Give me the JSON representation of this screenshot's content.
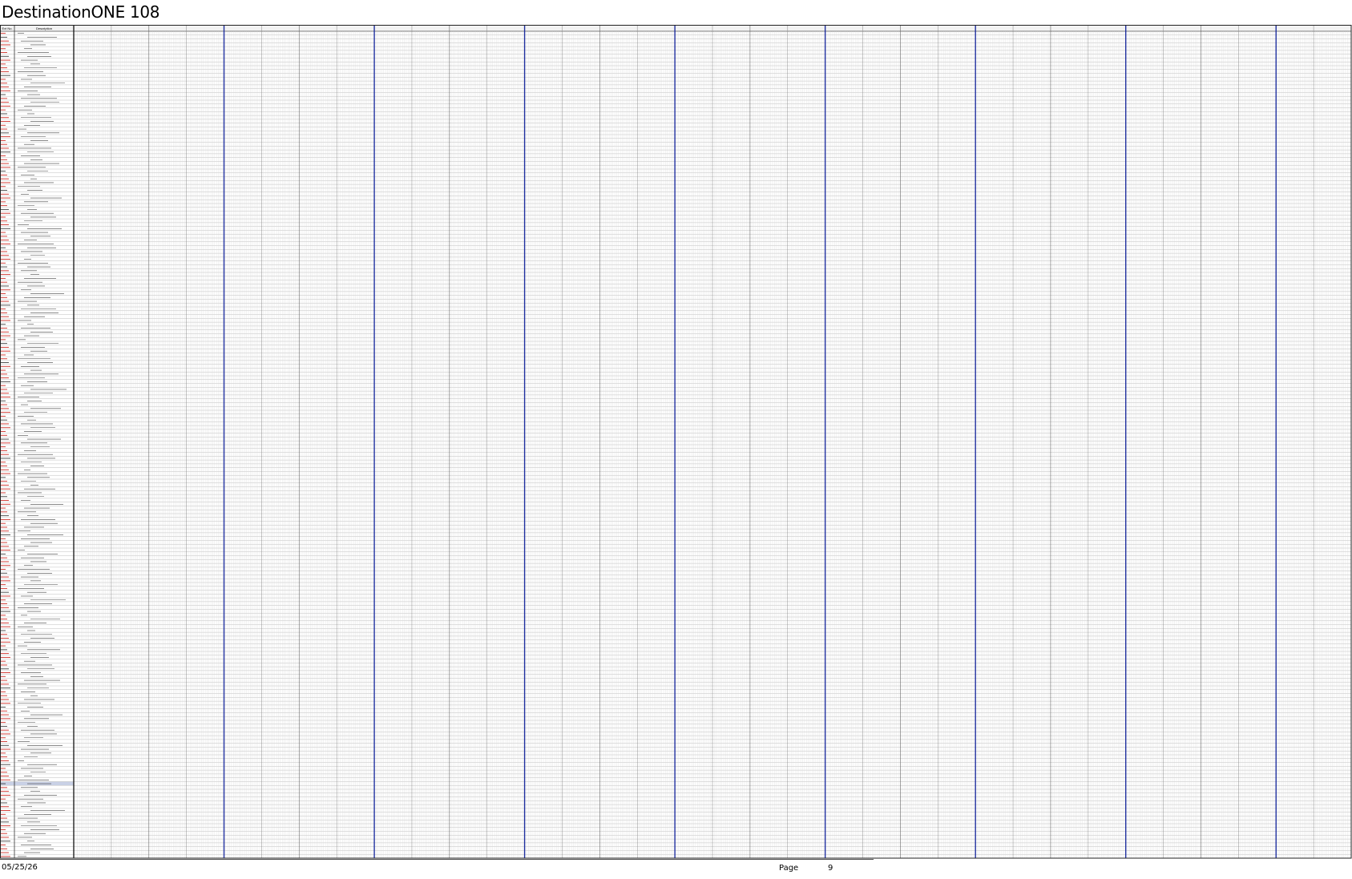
{
  "page": {
    "title": "DestinationONE 108",
    "footer_date": "05/25/26",
    "footer_page_label": "Page",
    "footer_page_number": "9"
  },
  "table": {
    "header_labels": [
      "Ext No.",
      "Description"
    ],
    "row_count": 216,
    "timeline_months": 17,
    "weeks_per_month": 2,
    "cells_per_week": 20,
    "colors": {
      "grid": "#bfbfbf",
      "month_divider": "#1f2f9e",
      "red_ext": "#d0302a",
      "dark_ext": "#444444",
      "header_fill": "#f2f2f2",
      "highlight_row": "#c9d1e6"
    },
    "highlight_row_index": 196
  }
}
